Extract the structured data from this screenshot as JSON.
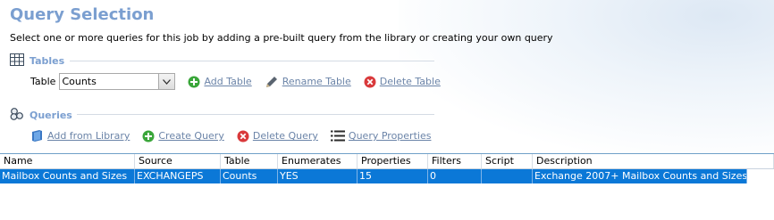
{
  "header": {
    "title": "Query Selection",
    "subtitle": "Select one or more queries for this job by adding a pre-built query from the library or creating your own query"
  },
  "tables_section": {
    "label": "Tables",
    "icon": "table-grid-icon",
    "table_label": "Table",
    "selected_table": "Counts",
    "actions": {
      "add": "Add Table",
      "rename": "Rename Table",
      "delete": "Delete Table"
    }
  },
  "queries_section": {
    "label": "Queries",
    "icon": "queries-icon",
    "actions": {
      "add_from_library": "Add from Library",
      "create": "Create Query",
      "delete": "Delete Query",
      "properties": "Query Properties"
    }
  },
  "grid": {
    "columns": [
      "Name",
      "Source",
      "Table",
      "Enumerates",
      "Properties",
      "Filters",
      "Script",
      "Description"
    ],
    "rows": [
      {
        "name": "Mailbox Counts and Sizes",
        "source": "EXCHANGEPS",
        "table": "Counts",
        "enumerates": "YES",
        "properties": "15",
        "filters": "0",
        "script": "",
        "description": "Exchange 2007+ Mailbox Counts and Sizes",
        "selected": true
      }
    ]
  },
  "colors": {
    "title": "#7b9fd0",
    "link": "#6b84a8",
    "selection": "#0b78d7",
    "add_green": "#3aa63a",
    "delete_red": "#d9393b"
  }
}
